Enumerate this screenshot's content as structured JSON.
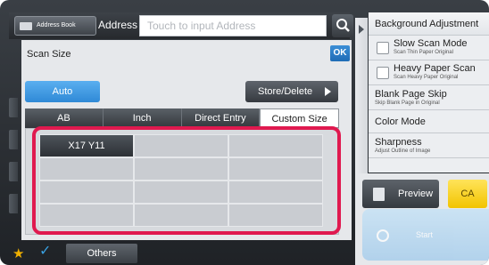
{
  "topbar": {
    "address_book_label": "Address Book",
    "address_label": "Address",
    "address_placeholder": "Touch to input Address",
    "search_icon": "search-icon"
  },
  "dialog": {
    "title": "Scan Size",
    "ok_label": "OK",
    "auto_label": "Auto",
    "store_delete_label": "Store/Delete",
    "tabs": [
      {
        "label": "AB",
        "active": false
      },
      {
        "label": "Inch",
        "active": false
      },
      {
        "label": "Direct Entry",
        "active": false
      },
      {
        "label": "Custom Size",
        "active": true
      }
    ],
    "custom_sizes": [
      {
        "label": "X17  Y11",
        "selected": true
      },
      {
        "label": ""
      },
      {
        "label": ""
      },
      {
        "label": ""
      },
      {
        "label": ""
      },
      {
        "label": ""
      },
      {
        "label": ""
      },
      {
        "label": ""
      },
      {
        "label": ""
      },
      {
        "label": ""
      },
      {
        "label": ""
      },
      {
        "label": ""
      }
    ]
  },
  "right_panel": {
    "background_adjustment": "Background Adjustment",
    "slow_scan_title": "Slow Scan Mode",
    "slow_scan_sub": "Scan Thin Paper Original",
    "heavy_paper_title": "Heavy Paper Scan",
    "heavy_paper_sub": "Scan Heavy Paper Original",
    "blank_page_title": "Blank Page Skip",
    "blank_page_sub": "Skip Blank Page in Original",
    "color_mode": "Color Mode",
    "sharpness_title": "Sharpness",
    "sharpness_sub": "Adjust Outline of Image"
  },
  "actions": {
    "preview_label": "Preview",
    "ca_label": "CA",
    "start_label": "Start"
  },
  "bottom": {
    "others_label": "Others"
  },
  "colors": {
    "accent_blue": "#2f89d6",
    "ca_yellow": "#f2c400",
    "highlight_red": "#e0194f"
  }
}
